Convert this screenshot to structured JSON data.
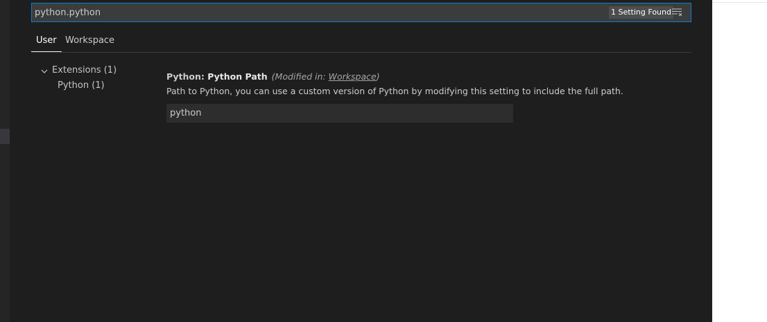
{
  "search": {
    "value": "python.python",
    "result_count": "1 Setting Found",
    "filter_icon": "clear-filter-icon"
  },
  "tabs": [
    {
      "label": "User",
      "active": true
    },
    {
      "label": "Workspace",
      "active": false
    }
  ],
  "toc": {
    "extensions_label": "Extensions (1)",
    "python_label": "Python (1)",
    "expand_icon": "chevron-down-icon"
  },
  "setting": {
    "category": "Python: ",
    "label": "Python Path",
    "modified_prefix": "(Modified in: ",
    "modified_link": "Workspace",
    "modified_suffix": ")",
    "description": "Path to Python, you can use a custom version of Python by modifying this setting to include the full path.",
    "value": "python"
  },
  "colors": {
    "editor_background": "#1e1e1e",
    "focus_border": "#007fd4",
    "input_background": "#3c3c3c",
    "setting_input_background": "#2d2d2d",
    "badge_background": "#4d4d4d",
    "text": "#cccccc"
  }
}
